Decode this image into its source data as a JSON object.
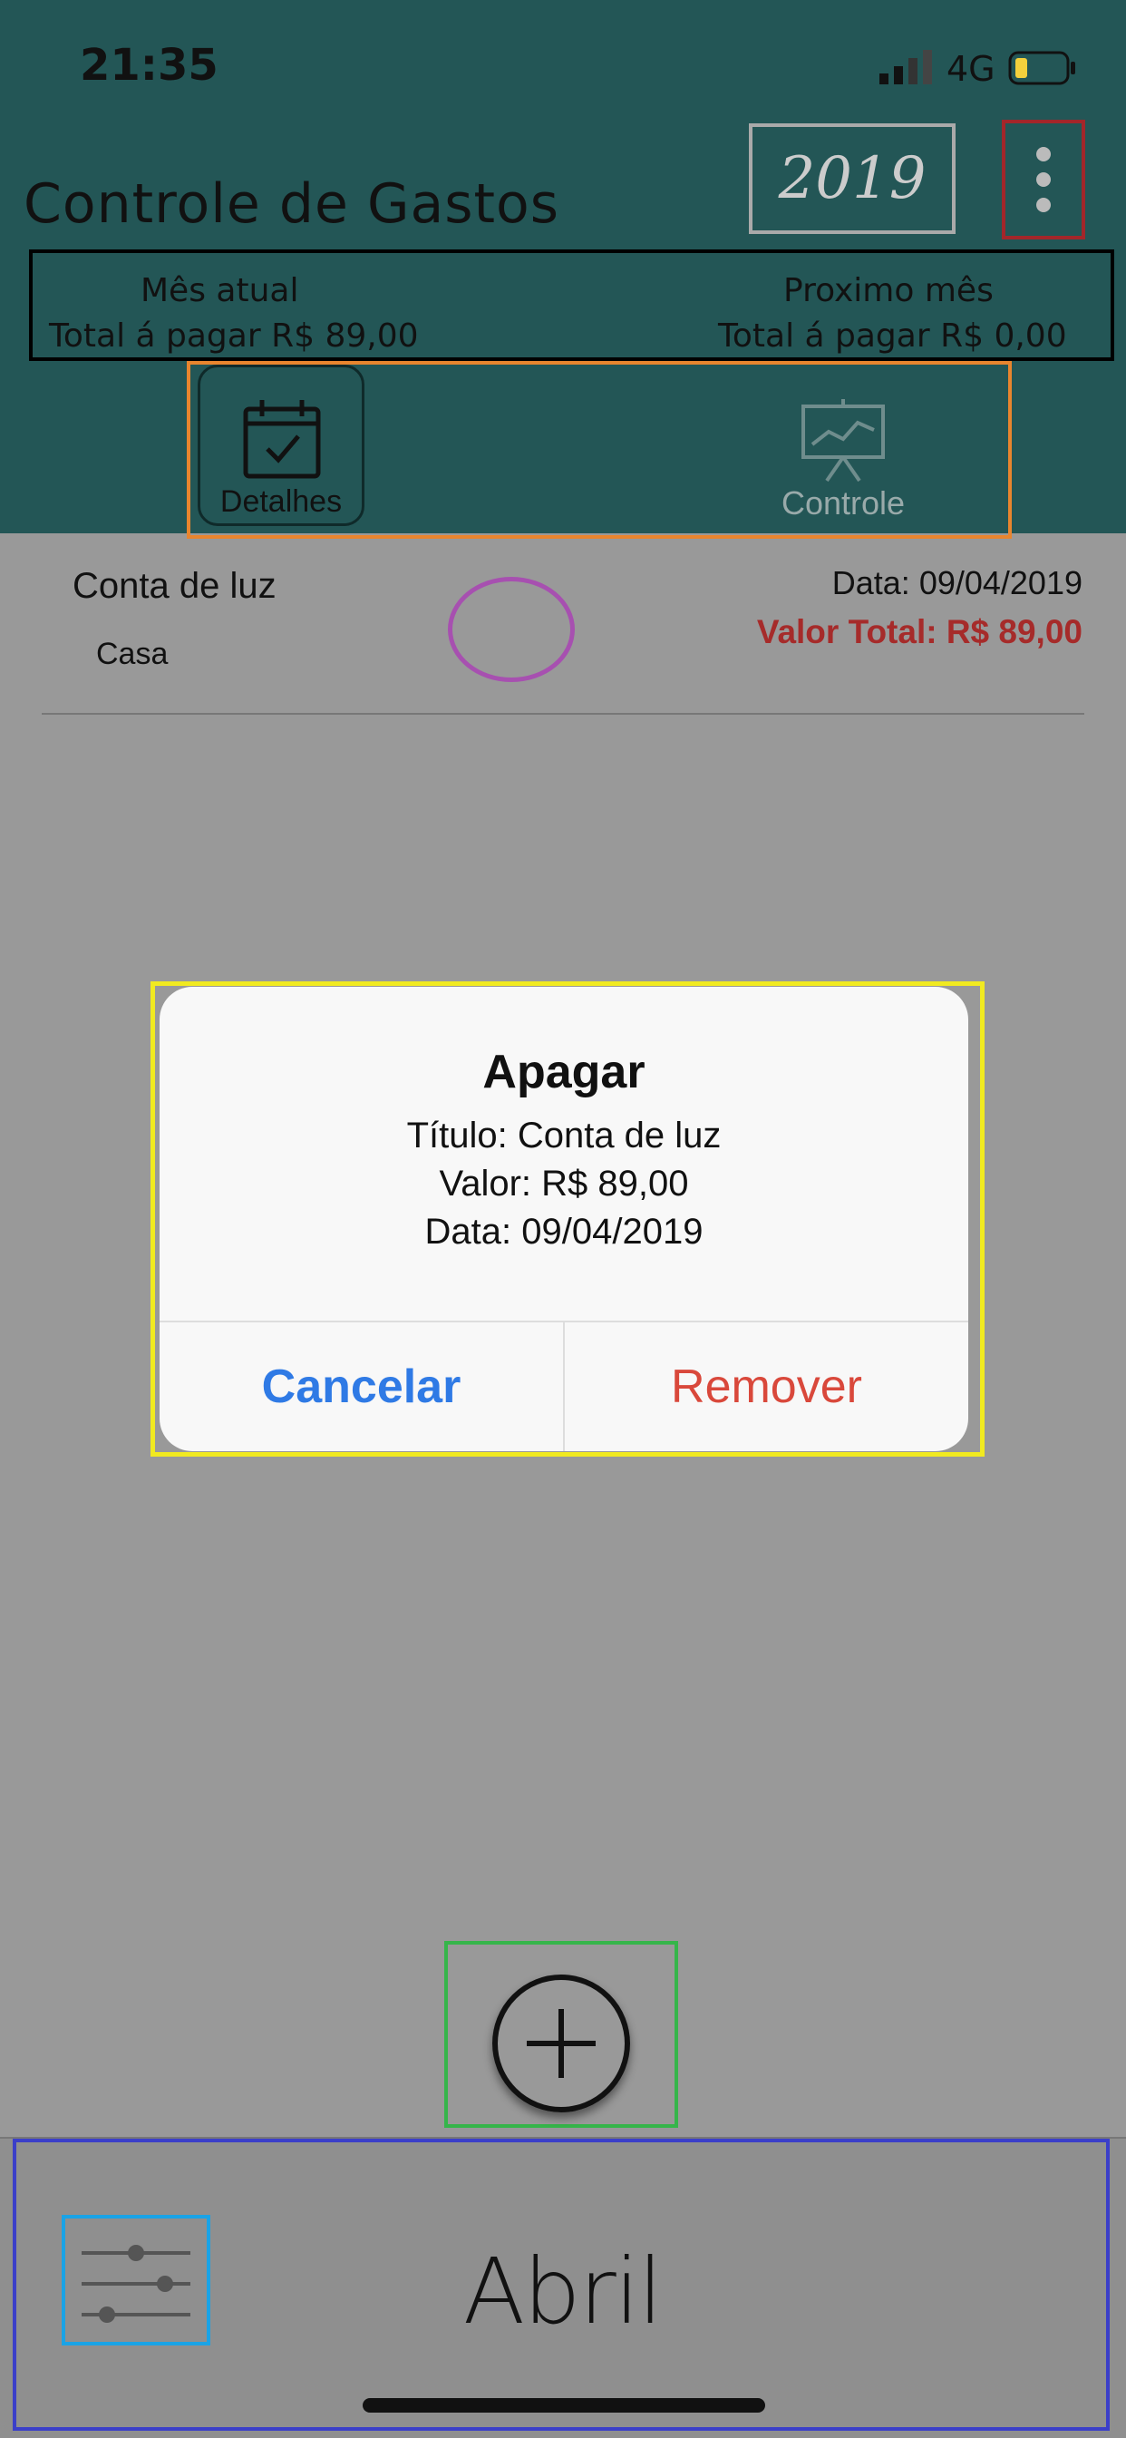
{
  "status_bar": {
    "time": "21:35",
    "network": "4G"
  },
  "header": {
    "title": "Controle de Gastos",
    "year": "2019",
    "current_month": {
      "label": "Mês atual",
      "total": "Total á pagar  R$ 89,00"
    },
    "next_month": {
      "label": "Proximo mês",
      "total": "Total á pagar  R$ 0,00"
    },
    "tabs": [
      {
        "label": "Detalhes",
        "icon": "calendar-check-icon",
        "selected": true
      },
      {
        "label": "Controle",
        "icon": "chart-board-icon",
        "selected": false
      }
    ]
  },
  "list": {
    "items": [
      {
        "title": "Conta de luz",
        "category": "Casa",
        "date": "Data: 09/04/2019",
        "total": "Valor Total: R$ 89,00"
      }
    ]
  },
  "dialog": {
    "title": "Apagar",
    "lines": [
      "Título: Conta de luz",
      "Valor: R$ 89,00",
      "Data: 09/04/2019"
    ],
    "cancel_label": "Cancelar",
    "remove_label": "Remover"
  },
  "bottom_bar": {
    "month": "Abril",
    "filter_icon": "sliders-icon"
  },
  "colors": {
    "header_bg": "#235656",
    "value_red": "#a62b2a",
    "cancel_blue": "#2f7ae5",
    "remove_red": "#d9483b",
    "overlay_gray": "#999999"
  }
}
